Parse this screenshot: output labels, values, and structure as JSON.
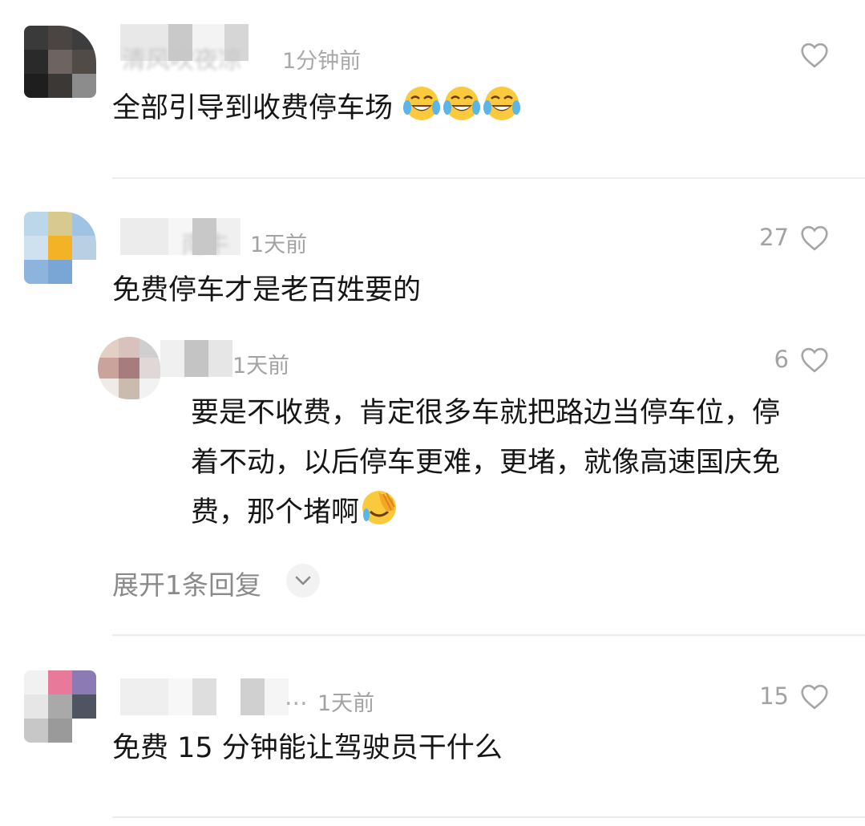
{
  "comments": [
    {
      "name": "清风吹夜凉",
      "time": "1分钟前",
      "text": "全部引导到收费停车场",
      "emoji": "tears-of-joy-emoji x3",
      "likes": ""
    },
    {
      "name": "南牛",
      "time": "1天前",
      "text": "免费停车才是老百姓要的",
      "likes": "27"
    },
    {
      "name": "",
      "time": "1天前",
      "text": "要是不收费，肯定很多车就把路边当停车位，停着不动，以后停车更难，更堵，就像高速国庆免费，那个堵啊",
      "emoji": "crying-facepalm-emoji",
      "likes": "6"
    },
    {
      "name": "...",
      "time": "1天前",
      "text": "免费 15 分钟能让驾驶员干什么",
      "likes": "15"
    }
  ],
  "expand_replies": "展开1条回复",
  "colors": {
    "text": "#161616",
    "meta": "#a2a2a2",
    "divider": "#ededed"
  }
}
